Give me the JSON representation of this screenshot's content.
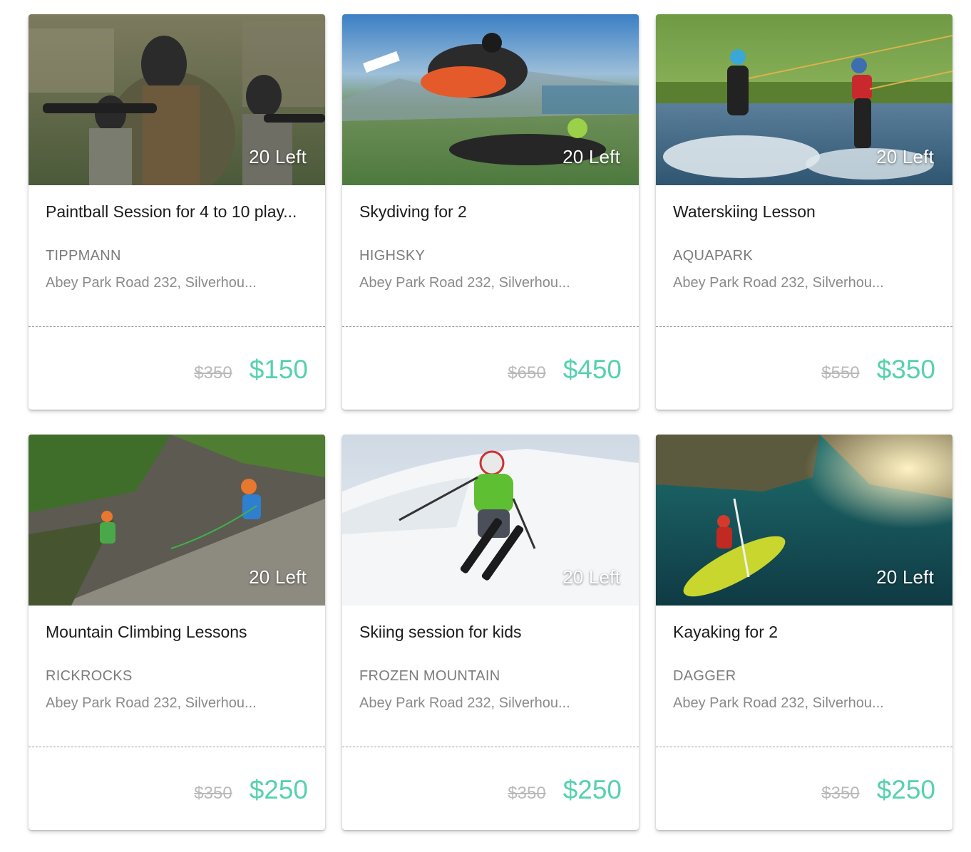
{
  "colors": {
    "accent_price": "#55d1b0",
    "old_price": "#b9b9b9",
    "title": "#1b1b1b",
    "meta": "#7c7c7c"
  },
  "deals": [
    {
      "image": "paintball-photo",
      "badge": "20 Left",
      "title": "Paintball Session for 4 to 10 play...",
      "vendor": "TIPPMANN",
      "address": "Abey Park Road 232, Silverhou...",
      "old_price": "$350",
      "price": "$150"
    },
    {
      "image": "skydiving-photo",
      "badge": "20 Left",
      "title": "Skydiving for 2",
      "vendor": "HIGHSKY",
      "address": "Abey Park Road 232, Silverhou...",
      "old_price": "$650",
      "price": "$450"
    },
    {
      "image": "waterskiing-photo",
      "badge": "20 Left",
      "title": "Waterskiing Lesson",
      "vendor": "AQUAPARK",
      "address": "Abey Park Road 232, Silverhou...",
      "old_price": "$550",
      "price": "$350"
    },
    {
      "image": "climbing-photo",
      "badge": "20 Left",
      "title": "Mountain Climbing Lessons",
      "vendor": "RICKROCKS",
      "address": "Abey Park Road 232, Silverhou...",
      "old_price": "$350",
      "price": "$250"
    },
    {
      "image": "skiing-photo",
      "badge": "20 Left",
      "title": "Skiing session for kids",
      "vendor": "FROZEN MOUNTAIN",
      "address": "Abey Park Road 232, Silverhou...",
      "old_price": "$350",
      "price": "$250"
    },
    {
      "image": "kayaking-photo",
      "badge": "20 Left",
      "title": "Kayaking for 2",
      "vendor": "DAGGER",
      "address": "Abey Park Road 232, Silverhou...",
      "old_price": "$350",
      "price": "$250"
    }
  ]
}
